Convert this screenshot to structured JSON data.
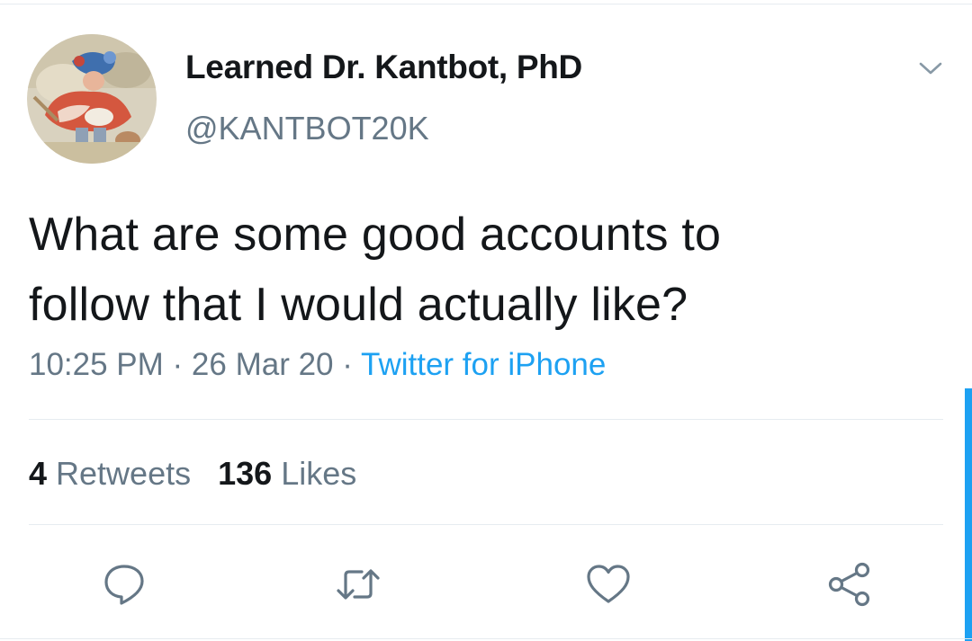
{
  "author": {
    "display_name": "Learned Dr. Kantbot, PhD",
    "handle": "@KANTBOT20K",
    "avatar_icon": "painting-portrait-avatar"
  },
  "tweet": {
    "text_line1": "What are some good accounts to",
    "text_line2": "follow that I would actually like?",
    "time": "10:25 PM",
    "date": "26 Mar 20",
    "separator": " · ",
    "source": "Twitter for iPhone"
  },
  "stats": {
    "retweets_count": "4",
    "retweets_label": " Retweets",
    "likes_count": "136",
    "likes_label": " Likes"
  },
  "actions": {
    "reply_icon": "reply-icon",
    "retweet_icon": "retweet-icon",
    "like_icon": "heart-icon",
    "share_icon": "share-icon"
  },
  "colors": {
    "text_primary": "#14171a",
    "text_secondary": "#657786",
    "accent": "#1da1f2",
    "divider": "#e6ecf0",
    "icon": "#657786"
  }
}
